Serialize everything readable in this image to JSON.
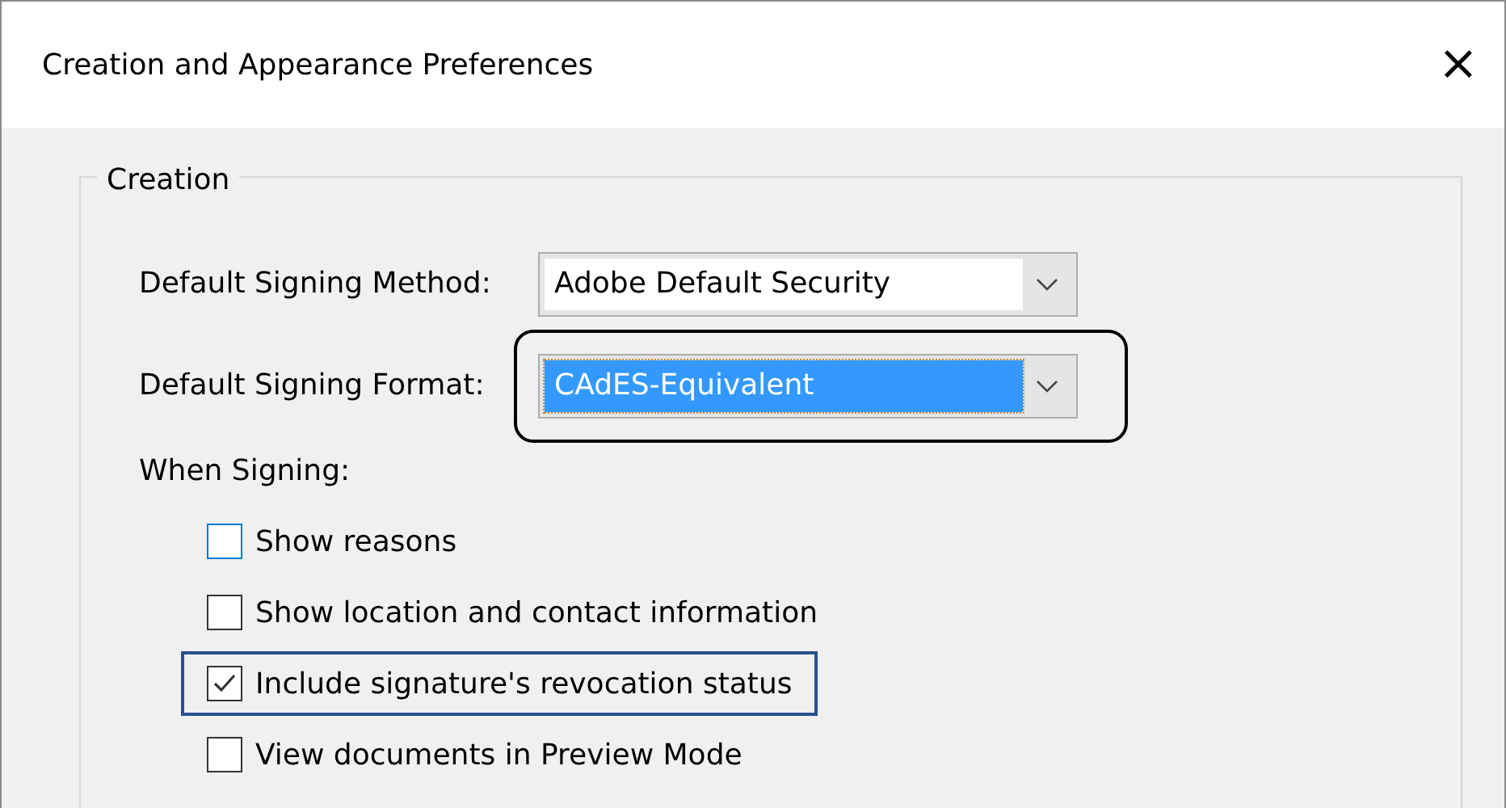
{
  "window": {
    "title": "Creation and Appearance Preferences",
    "close": "×"
  },
  "group": {
    "title": "Creation",
    "fields": [
      {
        "label": "Default Signing Method:",
        "value": "Adobe Default Security",
        "focused": false,
        "highlighted": false
      },
      {
        "label": "Default Signing Format:",
        "value": "CAdES-Equivalent",
        "focused": true,
        "highlighted": true
      }
    ],
    "section_label": "When Signing:",
    "options": [
      {
        "label": "Show reasons",
        "checked": false,
        "hovered": true,
        "focused": false
      },
      {
        "label": "Show location and contact information",
        "checked": false,
        "hovered": false,
        "focused": false
      },
      {
        "label": "Include signature's revocation status",
        "checked": true,
        "hovered": false,
        "focused": true
      },
      {
        "label": "View documents in Preview Mode",
        "checked": false,
        "hovered": false,
        "focused": false
      }
    ]
  }
}
